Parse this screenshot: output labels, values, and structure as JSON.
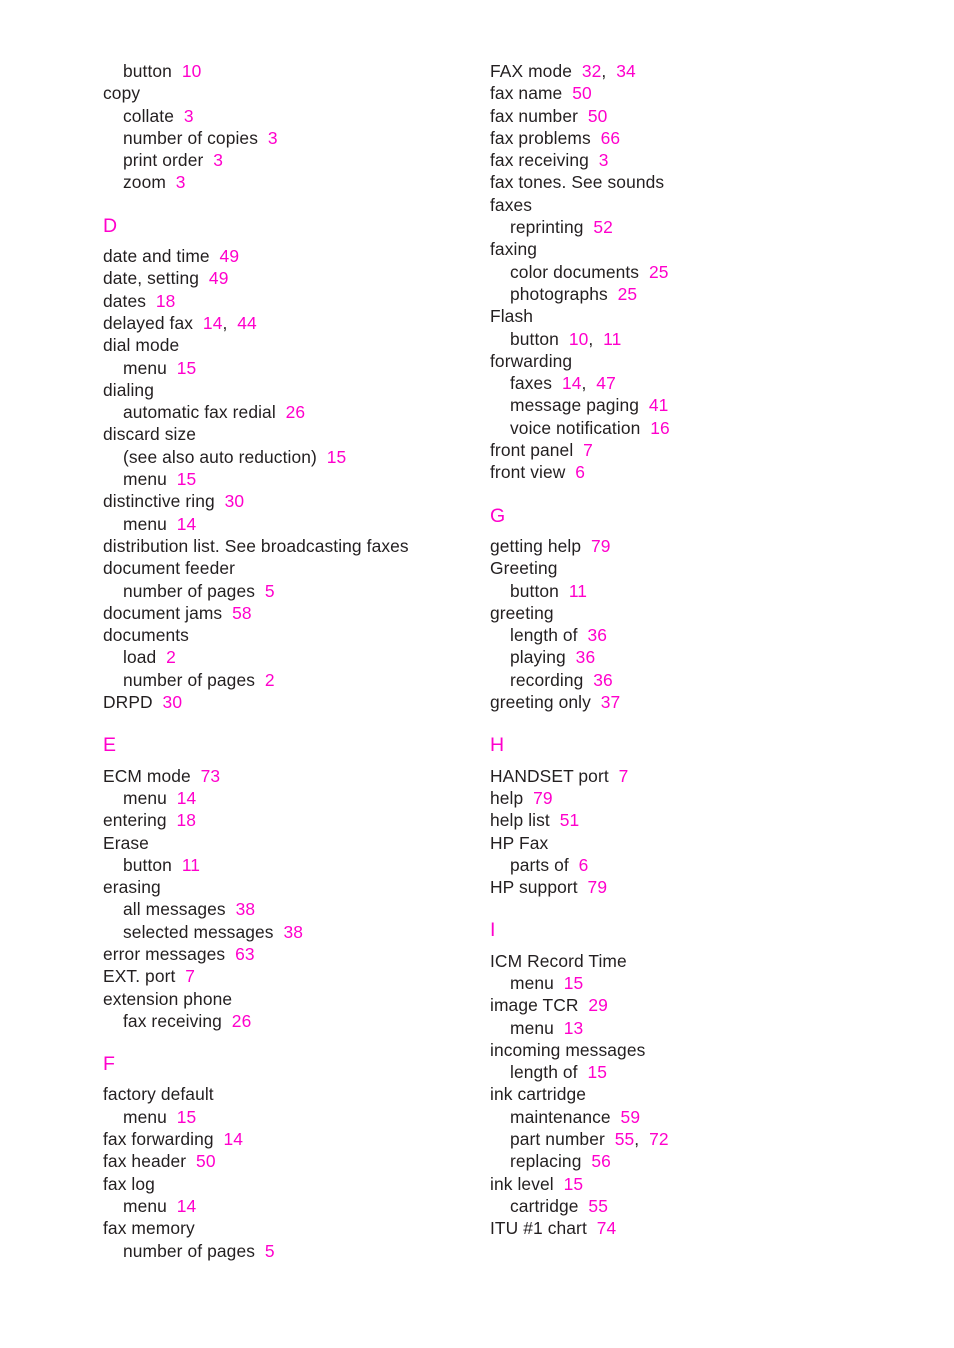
{
  "page": {
    "type": "book-index",
    "accent_color": "#ff00cc",
    "text_color": "#231f20",
    "background_color": "#ffffff"
  },
  "columns": [
    {
      "name": "left-column",
      "blocks": [
        {
          "kind": "entries",
          "entries": [
            {
              "level": 2,
              "term": "button",
              "pages": [
                "10"
              ]
            },
            {
              "level": 1,
              "term": "copy",
              "pages": []
            },
            {
              "level": 2,
              "term": "collate",
              "pages": [
                "3"
              ]
            },
            {
              "level": 2,
              "term": "number of copies",
              "pages": [
                "3"
              ]
            },
            {
              "level": 2,
              "term": "print order",
              "pages": [
                "3"
              ]
            },
            {
              "level": 2,
              "term": "zoom",
              "pages": [
                "3"
              ]
            }
          ]
        },
        {
          "kind": "letter",
          "letter": "D",
          "entries": [
            {
              "level": 1,
              "term": "date and time",
              "pages": [
                "49"
              ]
            },
            {
              "level": 1,
              "term": "date, setting",
              "pages": [
                "49"
              ]
            },
            {
              "level": 1,
              "term": "dates",
              "pages": [
                "18"
              ]
            },
            {
              "level": 1,
              "term": "delayed fax",
              "pages": [
                "14",
                "44"
              ]
            },
            {
              "level": 1,
              "term": "dial mode",
              "pages": []
            },
            {
              "level": 2,
              "term": "menu",
              "pages": [
                "15"
              ]
            },
            {
              "level": 1,
              "term": "dialing",
              "pages": []
            },
            {
              "level": 2,
              "term": "automatic fax redial",
              "pages": [
                "26"
              ]
            },
            {
              "level": 1,
              "term": "discard size",
              "pages": []
            },
            {
              "level": 2,
              "term": "(see also auto reduction)",
              "pages": [
                "15"
              ]
            },
            {
              "level": 2,
              "term": "menu",
              "pages": [
                "15"
              ]
            },
            {
              "level": 1,
              "term": "distinctive ring",
              "pages": [
                "30"
              ]
            },
            {
              "level": 2,
              "term": "menu",
              "pages": [
                "14"
              ]
            },
            {
              "level": 1,
              "term": "distribution list. See broadcasting faxes",
              "pages": []
            },
            {
              "level": 1,
              "term": "document feeder",
              "pages": []
            },
            {
              "level": 2,
              "term": "number of pages",
              "pages": [
                "5"
              ]
            },
            {
              "level": 1,
              "term": "document jams",
              "pages": [
                "58"
              ]
            },
            {
              "level": 1,
              "term": "documents",
              "pages": []
            },
            {
              "level": 2,
              "term": "load",
              "pages": [
                "2"
              ]
            },
            {
              "level": 2,
              "term": "number of pages",
              "pages": [
                "2"
              ]
            },
            {
              "level": 1,
              "term": "DRPD",
              "pages": [
                "30"
              ]
            }
          ]
        },
        {
          "kind": "letter",
          "letter": "E",
          "entries": [
            {
              "level": 1,
              "term": "ECM mode",
              "pages": [
                "73"
              ]
            },
            {
              "level": 2,
              "term": "menu",
              "pages": [
                "14"
              ]
            },
            {
              "level": 1,
              "term": "entering",
              "pages": [
                "18"
              ]
            },
            {
              "level": 1,
              "term": "Erase",
              "pages": []
            },
            {
              "level": 2,
              "term": "button",
              "pages": [
                "11"
              ]
            },
            {
              "level": 1,
              "term": "erasing",
              "pages": []
            },
            {
              "level": 2,
              "term": "all messages",
              "pages": [
                "38"
              ]
            },
            {
              "level": 2,
              "term": "selected messages",
              "pages": [
                "38"
              ]
            },
            {
              "level": 1,
              "term": "error messages",
              "pages": [
                "63"
              ]
            },
            {
              "level": 1,
              "term": "EXT. port",
              "pages": [
                "7"
              ]
            },
            {
              "level": 1,
              "term": "extension phone",
              "pages": []
            },
            {
              "level": 2,
              "term": "fax receiving",
              "pages": [
                "26"
              ]
            }
          ]
        },
        {
          "kind": "letter",
          "letter": "F",
          "entries": [
            {
              "level": 1,
              "term": "factory default",
              "pages": []
            },
            {
              "level": 2,
              "term": "menu",
              "pages": [
                "15"
              ]
            },
            {
              "level": 1,
              "term": "fax forwarding",
              "pages": [
                "14"
              ]
            },
            {
              "level": 1,
              "term": "fax header",
              "pages": [
                "50"
              ]
            },
            {
              "level": 1,
              "term": "fax log",
              "pages": []
            },
            {
              "level": 2,
              "term": "menu",
              "pages": [
                "14"
              ]
            },
            {
              "level": 1,
              "term": "fax memory",
              "pages": []
            },
            {
              "level": 2,
              "term": "number of pages",
              "pages": [
                "5"
              ]
            }
          ]
        }
      ]
    },
    {
      "name": "right-column",
      "blocks": [
        {
          "kind": "entries",
          "entries": [
            {
              "level": 1,
              "term": "FAX mode",
              "pages": [
                "32",
                "34"
              ]
            },
            {
              "level": 1,
              "term": "fax name",
              "pages": [
                "50"
              ]
            },
            {
              "level": 1,
              "term": "fax number",
              "pages": [
                "50"
              ]
            },
            {
              "level": 1,
              "term": "fax problems",
              "pages": [
                "66"
              ]
            },
            {
              "level": 1,
              "term": "fax receiving",
              "pages": [
                "3"
              ]
            },
            {
              "level": 1,
              "term": "fax tones. See sounds",
              "pages": []
            },
            {
              "level": 1,
              "term": "faxes",
              "pages": []
            },
            {
              "level": 2,
              "term": "reprinting",
              "pages": [
                "52"
              ]
            },
            {
              "level": 1,
              "term": "faxing",
              "pages": []
            },
            {
              "level": 2,
              "term": "color documents",
              "pages": [
                "25"
              ]
            },
            {
              "level": 2,
              "term": "photographs",
              "pages": [
                "25"
              ]
            },
            {
              "level": 1,
              "term": "Flash",
              "pages": []
            },
            {
              "level": 2,
              "term": "button",
              "pages": [
                "10",
                "11"
              ]
            },
            {
              "level": 1,
              "term": "forwarding",
              "pages": []
            },
            {
              "level": 2,
              "term": "faxes",
              "pages": [
                "14",
                "47"
              ]
            },
            {
              "level": 2,
              "term": "message paging",
              "pages": [
                "41"
              ]
            },
            {
              "level": 2,
              "term": "voice notification",
              "pages": [
                "16"
              ]
            },
            {
              "level": 1,
              "term": "front panel",
              "pages": [
                "7"
              ]
            },
            {
              "level": 1,
              "term": "front view",
              "pages": [
                "6"
              ]
            }
          ]
        },
        {
          "kind": "letter",
          "letter": "G",
          "entries": [
            {
              "level": 1,
              "term": "getting help",
              "pages": [
                "79"
              ]
            },
            {
              "level": 1,
              "term": "Greeting",
              "pages": []
            },
            {
              "level": 2,
              "term": "button",
              "pages": [
                "11"
              ]
            },
            {
              "level": 1,
              "term": "greeting",
              "pages": []
            },
            {
              "level": 2,
              "term": "length of",
              "pages": [
                "36"
              ]
            },
            {
              "level": 2,
              "term": "playing",
              "pages": [
                "36"
              ]
            },
            {
              "level": 2,
              "term": "recording",
              "pages": [
                "36"
              ]
            },
            {
              "level": 1,
              "term": "greeting only",
              "pages": [
                "37"
              ]
            }
          ]
        },
        {
          "kind": "letter",
          "letter": "H",
          "entries": [
            {
              "level": 1,
              "term": "HANDSET port",
              "pages": [
                "7"
              ]
            },
            {
              "level": 1,
              "term": "help",
              "pages": [
                "79"
              ]
            },
            {
              "level": 1,
              "term": "help list",
              "pages": [
                "51"
              ]
            },
            {
              "level": 1,
              "term": "HP Fax",
              "pages": []
            },
            {
              "level": 2,
              "term": "parts of",
              "pages": [
                "6"
              ]
            },
            {
              "level": 1,
              "term": "HP support",
              "pages": [
                "79"
              ]
            }
          ]
        },
        {
          "kind": "letter",
          "letter": "I",
          "entries": [
            {
              "level": 1,
              "term": "ICM Record Time",
              "pages": []
            },
            {
              "level": 2,
              "term": "menu",
              "pages": [
                "15"
              ]
            },
            {
              "level": 1,
              "term": "image TCR",
              "pages": [
                "29"
              ]
            },
            {
              "level": 2,
              "term": "menu",
              "pages": [
                "13"
              ]
            },
            {
              "level": 1,
              "term": "incoming messages",
              "pages": []
            },
            {
              "level": 2,
              "term": "length of",
              "pages": [
                "15"
              ]
            },
            {
              "level": 1,
              "term": "ink cartridge",
              "pages": []
            },
            {
              "level": 2,
              "term": "maintenance",
              "pages": [
                "59"
              ]
            },
            {
              "level": 2,
              "term": "part number",
              "pages": [
                "55",
                "72"
              ]
            },
            {
              "level": 2,
              "term": "replacing",
              "pages": [
                "56"
              ]
            },
            {
              "level": 1,
              "term": "ink level",
              "pages": [
                "15"
              ]
            },
            {
              "level": 2,
              "term": "cartridge",
              "pages": [
                "55"
              ]
            },
            {
              "level": 1,
              "term": "ITU #1 chart",
              "pages": [
                "74"
              ]
            }
          ]
        }
      ]
    }
  ]
}
